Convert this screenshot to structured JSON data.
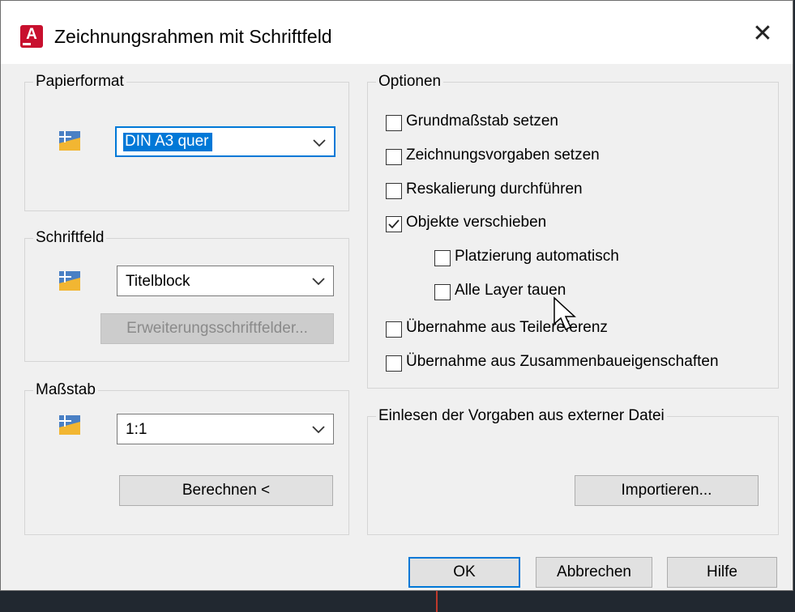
{
  "dialog": {
    "title": "Zeichnungsrahmen mit Schriftfeld",
    "icon_letter": "A",
    "close_glyph": "✕"
  },
  "papierformat": {
    "legend": "Papierformat",
    "selected": "DIN A3 quer"
  },
  "schriftfeld": {
    "legend": "Schriftfeld",
    "selected": "Titelblock",
    "extension_button": "Erweiterungsschriftfelder..."
  },
  "massstab": {
    "legend": "Maßstab",
    "selected": "1:1",
    "calc_button": "Berechnen <"
  },
  "optionen": {
    "legend": "Optionen",
    "items": [
      {
        "label": "Grundmaßstab setzen",
        "checked": false
      },
      {
        "label": "Zeichnungsvorgaben setzen",
        "checked": false
      },
      {
        "label": "Reskalierung durchführen",
        "checked": false
      },
      {
        "label": "Objekte verschieben",
        "checked": true
      },
      {
        "label": "Platzierung automatisch",
        "checked": false
      },
      {
        "label": "Alle Layer tauen",
        "checked": false
      },
      {
        "label": "Übernahme aus Teilereferenz",
        "checked": false
      },
      {
        "label": "Übernahme aus Zusammenbaueigenschaften",
        "checked": false
      }
    ]
  },
  "einlesen": {
    "legend": "Einlesen der Vorgaben aus externer Datei",
    "import_button": "Importieren..."
  },
  "footer": {
    "ok": "OK",
    "cancel": "Abbrechen",
    "help": "Hilfe"
  },
  "colors": {
    "accent": "#0078d7",
    "app_icon": "#c8102e"
  }
}
